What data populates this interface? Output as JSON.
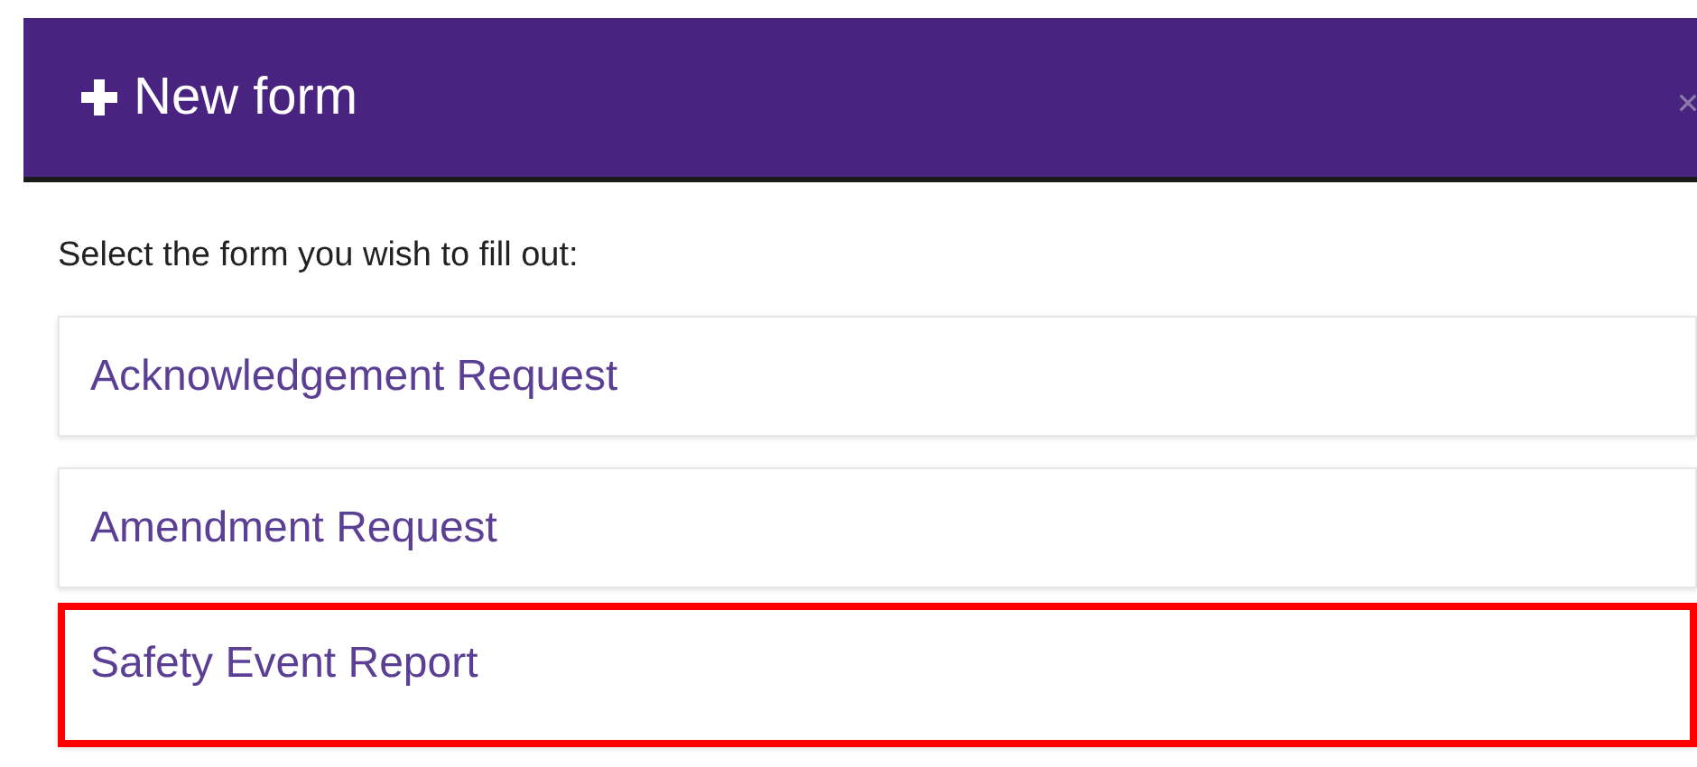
{
  "dialog": {
    "title": "New form",
    "prompt": "Select the form you wish to fill out:"
  },
  "forms": [
    {
      "label": "Acknowledgement Request",
      "highlighted": false
    },
    {
      "label": "Amendment Request",
      "highlighted": false
    },
    {
      "label": "Safety Event Report",
      "highlighted": true
    }
  ]
}
